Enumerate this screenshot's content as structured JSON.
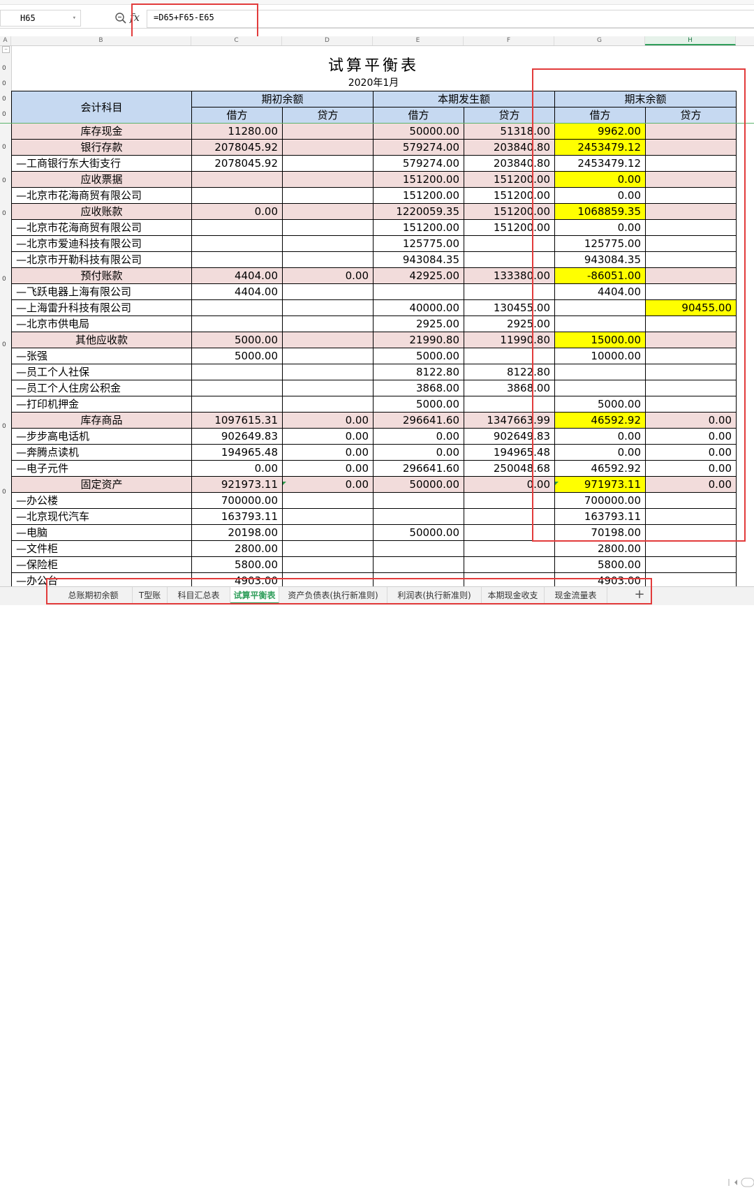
{
  "formula_bar": {
    "cell_ref": "H65",
    "formula": "=D65+F65-E65"
  },
  "columns": [
    "A",
    "B",
    "C",
    "D",
    "E",
    "F",
    "G",
    "H"
  ],
  "row_numbers": [
    "0",
    "0",
    "0",
    "0",
    "0",
    "0",
    "0",
    "0",
    "0",
    "0",
    "0"
  ],
  "sheet": {
    "title": "试算平衡表",
    "date": "2020年1月",
    "header": {
      "account": "会计科目",
      "opening": "期初余额",
      "period": "本期发生额",
      "closing": "期末余额",
      "debit": "借方",
      "credit": "贷方"
    },
    "rows": [
      {
        "name": "库存现金",
        "category": true,
        "c": "11280.00",
        "d": "",
        "e": "50000.00",
        "f": "51318.00",
        "g": "9962.00",
        "h": ""
      },
      {
        "name": "银行存款",
        "category": true,
        "c": "2078045.92",
        "d": "",
        "e": "579274.00",
        "f": "203840.80",
        "g": "2453479.12",
        "h": ""
      },
      {
        "name": "—工商银行东大街支行",
        "category": false,
        "c": "2078045.92",
        "d": "",
        "e": "579274.00",
        "f": "203840.80",
        "g": "2453479.12",
        "h": ""
      },
      {
        "name": "应收票据",
        "category": true,
        "c": "",
        "d": "",
        "e": "151200.00",
        "f": "151200.00",
        "g": "0.00",
        "h": ""
      },
      {
        "name": "—北京市花海商贸有限公司",
        "category": false,
        "c": "",
        "d": "",
        "e": "151200.00",
        "f": "151200.00",
        "g": "0.00",
        "h": ""
      },
      {
        "name": "应收账款",
        "category": true,
        "c": "0.00",
        "d": "",
        "e": "1220059.35",
        "f": "151200.00",
        "g": "1068859.35",
        "h": ""
      },
      {
        "name": "—北京市花海商贸有限公司",
        "category": false,
        "c": "",
        "d": "",
        "e": "151200.00",
        "f": "151200.00",
        "g": "0.00",
        "h": ""
      },
      {
        "name": "—北京市爱迪科技有限公司",
        "category": false,
        "c": "",
        "d": "",
        "e": "125775.00",
        "f": "",
        "g": "125775.00",
        "h": ""
      },
      {
        "name": "—北京市开勒科技有限公司",
        "category": false,
        "c": "",
        "d": "",
        "e": "943084.35",
        "f": "",
        "g": "943084.35",
        "h": ""
      },
      {
        "name": "预付账款",
        "category": true,
        "c": "4404.00",
        "d": "0.00",
        "e": "42925.00",
        "f": "133380.00",
        "g": "-86051.00",
        "h": ""
      },
      {
        "name": "—飞跃电器上海有限公司",
        "category": false,
        "c": "4404.00",
        "d": "",
        "e": "",
        "f": "",
        "g": "4404.00",
        "h": ""
      },
      {
        "name": "—上海雷升科技有限公司",
        "category": false,
        "c": "",
        "d": "",
        "e": "40000.00",
        "f": "130455.00",
        "g": "",
        "h": "90455.00"
      },
      {
        "name": "—北京市供电局",
        "category": false,
        "c": "",
        "d": "",
        "e": "2925.00",
        "f": "2925.00",
        "g": "",
        "h": ""
      },
      {
        "name": "其他应收款",
        "category": true,
        "c": "5000.00",
        "d": "",
        "e": "21990.80",
        "f": "11990.80",
        "g": "15000.00",
        "h": ""
      },
      {
        "name": "—张强",
        "category": false,
        "c": "5000.00",
        "d": "",
        "e": "5000.00",
        "f": "",
        "g": "10000.00",
        "h": ""
      },
      {
        "name": "—员工个人社保",
        "category": false,
        "c": "",
        "d": "",
        "e": "8122.80",
        "f": "8122.80",
        "g": "",
        "h": ""
      },
      {
        "name": "—员工个人住房公积金",
        "category": false,
        "c": "",
        "d": "",
        "e": "3868.00",
        "f": "3868.00",
        "g": "",
        "h": ""
      },
      {
        "name": "—打印机押金",
        "category": false,
        "c": "",
        "d": "",
        "e": "5000.00",
        "f": "",
        "g": "5000.00",
        "h": ""
      },
      {
        "name": "库存商品",
        "category": true,
        "c": "1097615.31",
        "d": "0.00",
        "e": "296641.60",
        "f": "1347663.99",
        "g": "46592.92",
        "h": "0.00"
      },
      {
        "name": "—步步高电话机",
        "category": false,
        "c": "902649.83",
        "d": "0.00",
        "e": "0.00",
        "f": "902649.83",
        "g": "0.00",
        "h": "0.00"
      },
      {
        "name": "—奔腾点读机",
        "category": false,
        "c": "194965.48",
        "d": "0.00",
        "e": "0.00",
        "f": "194965.48",
        "g": "0.00",
        "h": "0.00"
      },
      {
        "name": "—电子元件",
        "category": false,
        "c": "0.00",
        "d": "0.00",
        "e": "296641.60",
        "f": "250048.68",
        "g": "46592.92",
        "h": "0.00"
      },
      {
        "name": "固定资产",
        "category": true,
        "c": "921973.11",
        "d": "0.00",
        "e": "50000.00",
        "f": "0.00",
        "g": "971973.11",
        "h": "0.00"
      },
      {
        "name": "—办公楼",
        "category": false,
        "c": "700000.00",
        "d": "",
        "e": "",
        "f": "",
        "g": "700000.00",
        "h": ""
      },
      {
        "name": "—北京现代汽车",
        "category": false,
        "c": "163793.11",
        "d": "",
        "e": "",
        "f": "",
        "g": "163793.11",
        "h": ""
      },
      {
        "name": "—电脑",
        "category": false,
        "c": "20198.00",
        "d": "",
        "e": "50000.00",
        "f": "",
        "g": "70198.00",
        "h": ""
      },
      {
        "name": "—文件柜",
        "category": false,
        "c": "2800.00",
        "d": "",
        "e": "",
        "f": "",
        "g": "2800.00",
        "h": ""
      },
      {
        "name": "—保险柜",
        "category": false,
        "c": "5800.00",
        "d": "",
        "e": "",
        "f": "",
        "g": "5800.00",
        "h": ""
      },
      {
        "name": "—办公台",
        "category": false,
        "c": "4903.00",
        "d": "",
        "e": "",
        "f": "",
        "g": "4903.00",
        "h": ""
      }
    ]
  },
  "tabs": [
    {
      "label": "总账期初余额",
      "active": false
    },
    {
      "label": "T型账",
      "active": false
    },
    {
      "label": "科目汇总表",
      "active": false
    },
    {
      "label": "试算平衡表",
      "active": true
    },
    {
      "label": "资产负债表(执行新准则)",
      "active": false
    },
    {
      "label": "利润表(执行新准则)",
      "active": false
    },
    {
      "label": "本期现金收支",
      "active": false
    },
    {
      "label": "现金流量表",
      "active": false
    }
  ],
  "add_sheet_label": "+",
  "highlight_color": "#ffff00",
  "category_row_color": "#f2dcdb",
  "header_color": "#c6d9f1",
  "annotation_color": "#e23b3b",
  "accent_color": "#2f9e5a"
}
